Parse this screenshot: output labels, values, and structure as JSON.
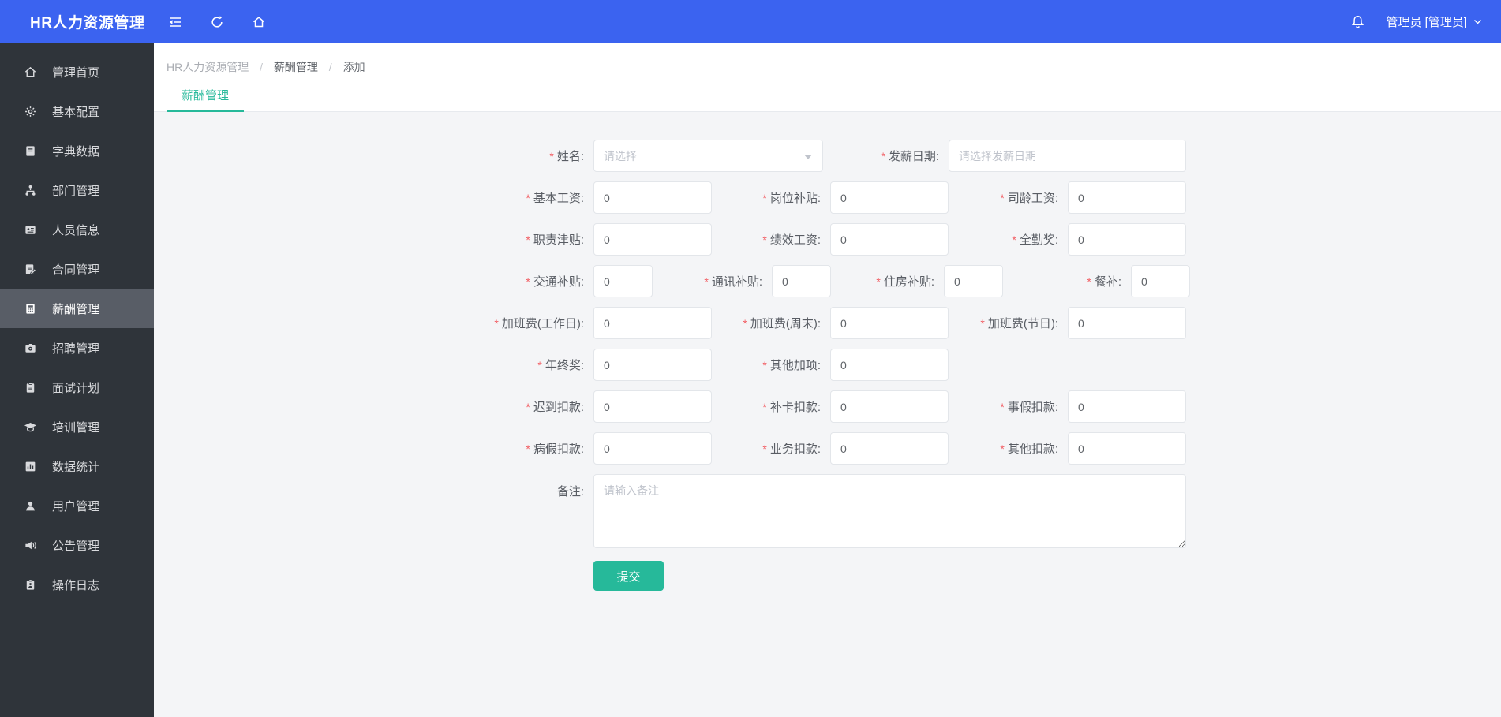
{
  "app": {
    "title": "HR人力资源管理"
  },
  "header": {
    "user_label": "管理员 [管理员]"
  },
  "sidebar": {
    "items": [
      {
        "label": "管理首页",
        "icon": "home-icon",
        "active": false
      },
      {
        "label": "基本配置",
        "icon": "gear-icon",
        "active": false
      },
      {
        "label": "字典数据",
        "icon": "dictionary-icon",
        "active": false
      },
      {
        "label": "部门管理",
        "icon": "org-chart-icon",
        "active": false
      },
      {
        "label": "人员信息",
        "icon": "id-card-icon",
        "active": false
      },
      {
        "label": "合同管理",
        "icon": "contract-icon",
        "active": false
      },
      {
        "label": "薪酬管理",
        "icon": "salary-icon",
        "active": true
      },
      {
        "label": "招聘管理",
        "icon": "recruit-camera-icon",
        "active": false
      },
      {
        "label": "面试计划",
        "icon": "interview-clipboard-icon",
        "active": false
      },
      {
        "label": "培训管理",
        "icon": "training-cap-icon",
        "active": false
      },
      {
        "label": "数据统计",
        "icon": "stats-chart-icon",
        "active": false
      },
      {
        "label": "用户管理",
        "icon": "user-icon",
        "active": false
      },
      {
        "label": "公告管理",
        "icon": "announcement-speaker-icon",
        "active": false
      },
      {
        "label": "操作日志",
        "icon": "operation-log-icon",
        "active": false
      }
    ]
  },
  "breadcrumb": {
    "separator": "/",
    "items": [
      "HR人力资源管理",
      "薪酬管理",
      "添加"
    ]
  },
  "tabs": {
    "active": "薪酬管理"
  },
  "form": {
    "required_mark": "*",
    "name": {
      "label": "姓名:",
      "required": true,
      "placeholder": "请选择"
    },
    "pay_date": {
      "label": "发薪日期:",
      "required": true,
      "placeholder": "请选择发薪日期"
    },
    "base_salary": {
      "label": "基本工资:",
      "required": true,
      "value": "0"
    },
    "post_allowance": {
      "label": "岗位补贴:",
      "required": true,
      "value": "0"
    },
    "seniority_salary": {
      "label": "司龄工资:",
      "required": true,
      "value": "0"
    },
    "duty_allowance": {
      "label": "职责津贴:",
      "required": true,
      "value": "0"
    },
    "performance_salary": {
      "label": "绩效工资:",
      "required": true,
      "value": "0"
    },
    "full_attendance_bonus": {
      "label": "全勤奖:",
      "required": true,
      "value": "0"
    },
    "transport_allowance": {
      "label": "交通补贴:",
      "required": true,
      "value": "0"
    },
    "communication_allowance": {
      "label": "通讯补贴:",
      "required": true,
      "value": "0"
    },
    "housing_allowance": {
      "label": "住房补贴:",
      "required": true,
      "value": "0"
    },
    "meal_allowance": {
      "label": "餐补:",
      "required": true,
      "value": "0"
    },
    "overtime_weekday": {
      "label": "加班费(工作日):",
      "required": true,
      "value": "0"
    },
    "overtime_weekend": {
      "label": "加班费(周末):",
      "required": true,
      "value": "0"
    },
    "overtime_holiday": {
      "label": "加班费(节日):",
      "required": true,
      "value": "0"
    },
    "year_end_bonus": {
      "label": "年终奖:",
      "required": true,
      "value": "0"
    },
    "other_addition": {
      "label": "其他加项:",
      "required": true,
      "value": "0"
    },
    "late_deduction": {
      "label": "迟到扣款:",
      "required": true,
      "value": "0"
    },
    "missed_punch_deduction": {
      "label": "补卡扣款:",
      "required": true,
      "value": "0"
    },
    "personal_leave_deduction": {
      "label": "事假扣款:",
      "required": true,
      "value": "0"
    },
    "sick_leave_deduction": {
      "label": "病假扣款:",
      "required": true,
      "value": "0"
    },
    "business_deduction": {
      "label": "业务扣款:",
      "required": true,
      "value": "0"
    },
    "other_deduction": {
      "label": "其他扣款:",
      "required": true,
      "value": "0"
    },
    "remark": {
      "label": "备注:",
      "required": false,
      "placeholder": "请输入备注"
    },
    "submit_label": "提交"
  },
  "colors": {
    "header_bg": "#3b63f0",
    "sidebar_bg": "#2f343a",
    "sidebar_active_bg": "#585d66",
    "accent_teal": "#26b99a",
    "required_red": "#f25c62",
    "content_bg": "#f4f5f7"
  }
}
